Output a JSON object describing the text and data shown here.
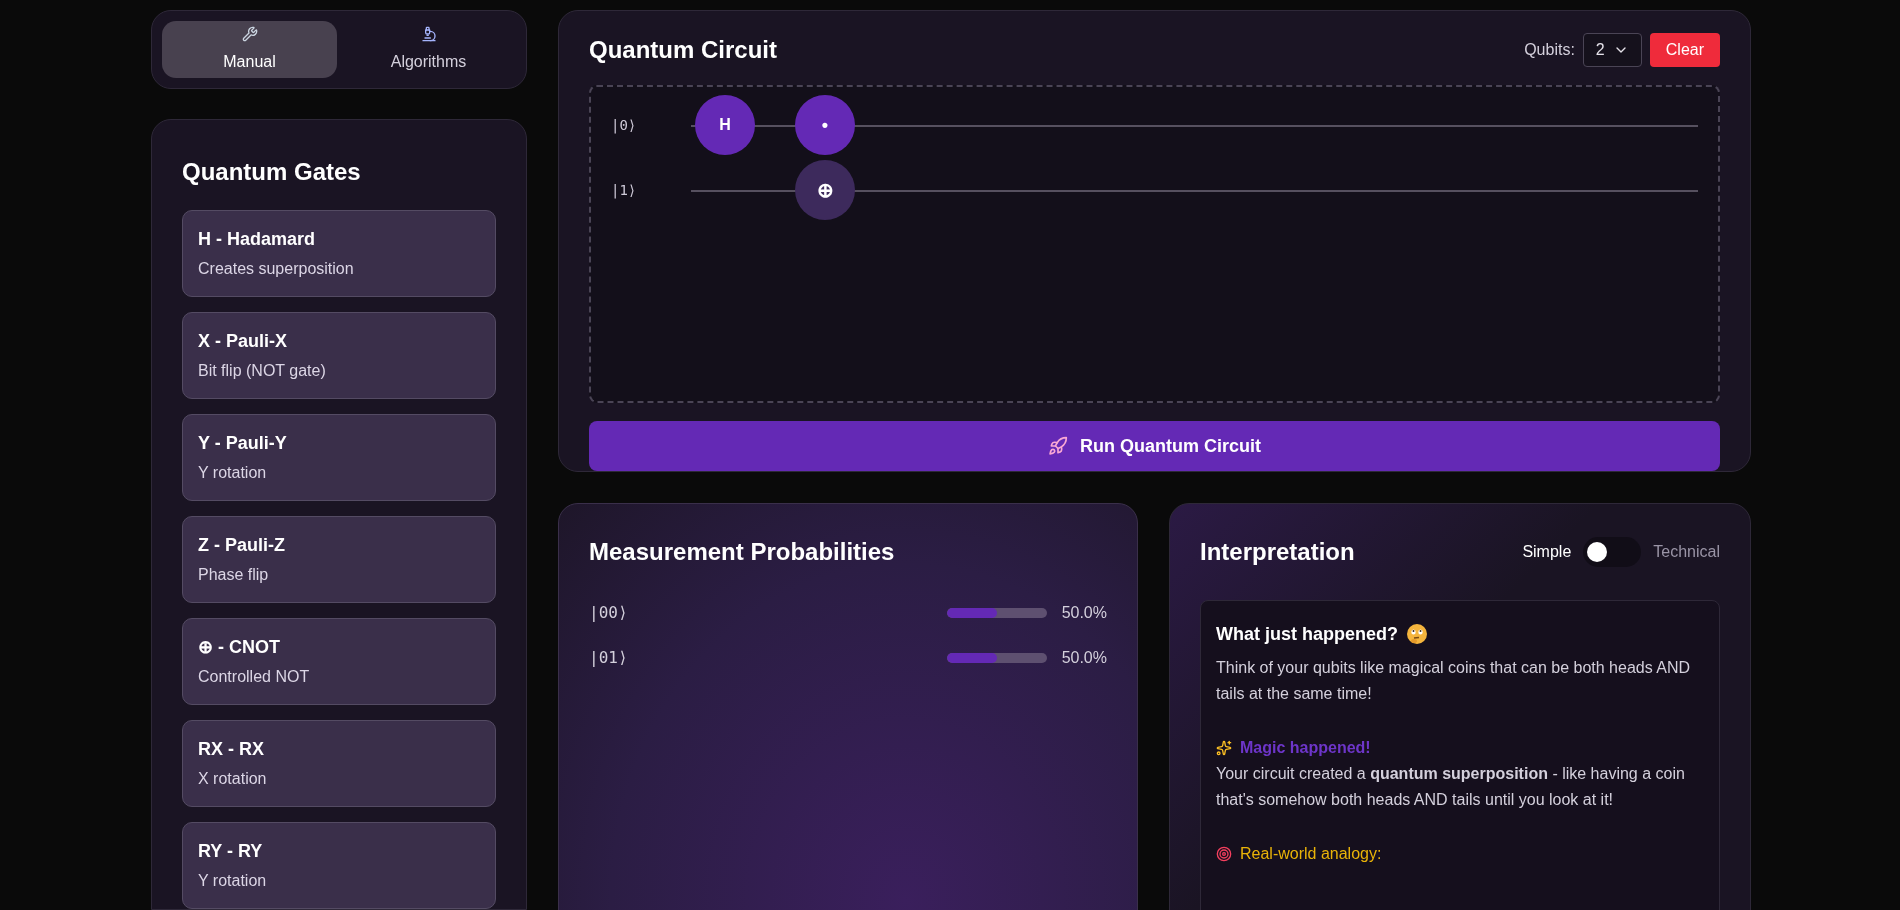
{
  "mode_tabs": [
    {
      "kind": "wrench",
      "label": "Manual",
      "selected": true
    },
    {
      "kind": "microscope",
      "label": "Algorithms",
      "selected": false
    }
  ],
  "gates_panel": {
    "title": "Quantum Gates",
    "gates": [
      {
        "name": "H - Hadamard",
        "description": "Creates superposition"
      },
      {
        "name": "X - Pauli-X",
        "description": "Bit flip (NOT gate)"
      },
      {
        "name": "Y - Pauli-Y",
        "description": "Y rotation"
      },
      {
        "name": "Z - Pauli-Z",
        "description": "Phase flip"
      },
      {
        "name": "⊕ - CNOT",
        "description": "Controlled NOT"
      },
      {
        "name": "RX - RX",
        "description": "X rotation"
      },
      {
        "name": "RY - RY",
        "description": "Y rotation"
      }
    ]
  },
  "circuit": {
    "title": "Quantum Circuit",
    "qubits_label": "Qubits:",
    "qubits_value": "2",
    "clear_button": "Clear",
    "wires": [
      "|0⟩",
      "|1⟩"
    ],
    "steps": [
      {
        "cells": [
          {
            "kind": "gate",
            "text": "H"
          },
          {
            "kind": "empty"
          }
        ]
      },
      {
        "cells": [
          {
            "kind": "control",
            "text": "•"
          },
          {
            "kind": "target",
            "text": "⊕"
          }
        ]
      }
    ],
    "run_button": "Run Quantum Circuit"
  },
  "probabilities": {
    "title": "Measurement Probabilities",
    "states": [
      {
        "state": "|00⟩",
        "level": 0.5,
        "reading": "50.0%"
      },
      {
        "state": "|01⟩",
        "level": 0.5,
        "reading": "50.0%"
      }
    ]
  },
  "interpretation": {
    "title": "Interpretation",
    "toggle_left": "Simple",
    "toggle_right": "Technical",
    "technical": false,
    "heading": "What just happened?",
    "blocks": [
      {
        "kind": "text",
        "text": "Think of your qubits like magical coins that can be both heads AND tails at the same time!"
      },
      {
        "kind": "magic",
        "title": "Magic happened!",
        "text": "Your circuit created a **quantum superposition** - like having a coin that's somehow both heads AND tails until you look at it!"
      },
      {
        "kind": "analogy",
        "title": "Real-world analogy:"
      }
    ]
  }
}
